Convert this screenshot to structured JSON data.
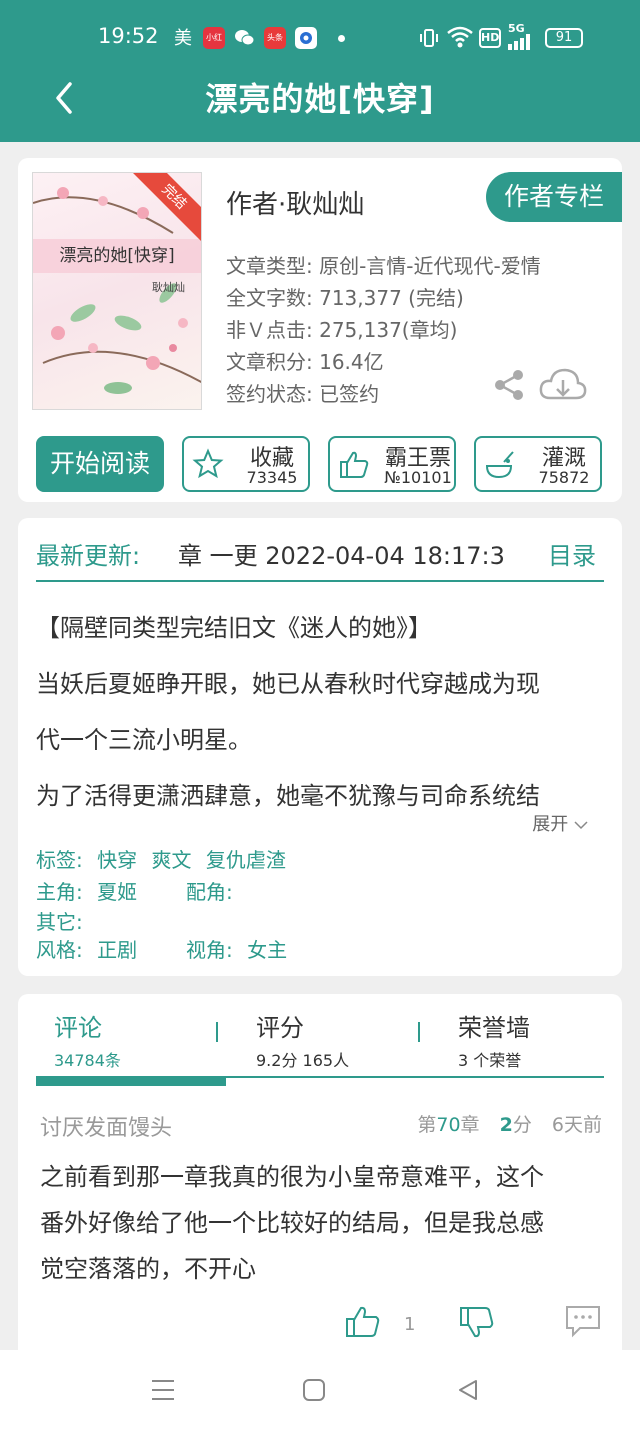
{
  "status_bar": {
    "time": "19:52",
    "carrier_glyph": "美",
    "apps": [
      {
        "name": "xiaohongshu-icon",
        "label": "小红书",
        "color": "#e5343f"
      },
      {
        "name": "wechat-icon",
        "label": "",
        "color": "#ffffff"
      },
      {
        "name": "toutiao-icon",
        "label": "头条",
        "color": "#e83a3a"
      },
      {
        "name": "round-app-icon",
        "label": "",
        "color": "#2a6fd3"
      }
    ],
    "battery": "91",
    "signal_label": "5G",
    "hd_label": "HD"
  },
  "header": {
    "title": "漂亮的她[快穿]"
  },
  "book": {
    "cover_title": "漂亮的她[快穿]",
    "cover_author": "耿灿灿",
    "cover_ribbon": "完结",
    "author": "作者·耿灿灿",
    "author_column_button": "作者专栏",
    "type_line": "文章类型: 原创-言情-近代现代-爱情",
    "words_line": "全文字数: 713,377 (完结)",
    "clicks_line": "非Ｖ点击: 275,137(章均)",
    "score_line": "文章积分: 16.4亿",
    "sign_line": "签约状态:   已签约"
  },
  "actions": {
    "read": "开始阅读",
    "fav_label": "收藏",
    "fav_count": "73345",
    "ticket_label": "霸王票",
    "ticket_count": "№10101",
    "water_label": "灌溉",
    "water_count": "75872"
  },
  "update": {
    "label": "最新更新:",
    "text": "章  一更  2022-04-04 18:17:3",
    "toc": "目录"
  },
  "description": {
    "lines": [
      "【隔壁同类型完结旧文《迷人的她》】",
      "当妖后夏姬睁开眼，她已从春秋时代穿越成为现",
      "代一个三流小明星。",
      "为了活得更潇洒肆意，她毫不犹豫与司命系统结"
    ],
    "expand": "展开"
  },
  "tags": {
    "tags_label": "标签:",
    "tags": [
      "快穿",
      "爽文",
      "复仇虐渣"
    ],
    "lead_label": "主角:",
    "lead": "夏姬",
    "support_label": "配角:",
    "support": "",
    "other_label": "其它:",
    "other": "",
    "style_label": "风格:",
    "style": "正剧",
    "view_label": "视角:",
    "view": "女主"
  },
  "tabs": [
    {
      "label": "评论",
      "sub": "34784条"
    },
    {
      "label": "评分",
      "sub": "9.2分 165人"
    },
    {
      "label": "荣誉墙",
      "sub": "3 个荣誉"
    }
  ],
  "comment": {
    "user": "讨厌发面馒头",
    "chapter_prefix": "第",
    "chapter_num": "70",
    "chapter_suffix": "章",
    "score_num": "2",
    "score_suffix": "分",
    "time": "6天前",
    "lines": [
      "之前看到那一章我真的很为小皇帝意难平，这个",
      "番外好像给了他一个比较好的结局，但是我总感",
      "觉空落落的，不开心"
    ],
    "likes": "1"
  }
}
